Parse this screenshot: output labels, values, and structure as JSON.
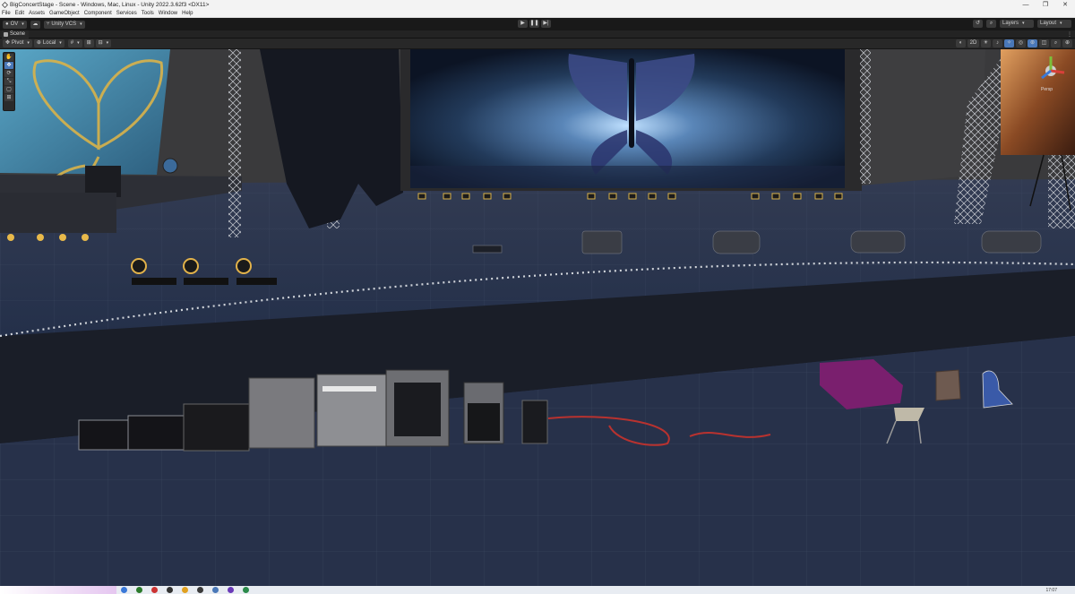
{
  "window": {
    "title": "BigConcertStage - Scene - Windows, Mac, Linux - Unity 2022.3.62f3 <DX11>",
    "controls": [
      "—",
      "❐",
      "✕"
    ]
  },
  "menu": [
    "File",
    "Edit",
    "Assets",
    "GameObject",
    "Component",
    "Services",
    "Tools",
    "Window",
    "Help"
  ],
  "main_toolbar": {
    "account": "OV",
    "version_control": "Unity VCS",
    "layers": "Layers",
    "layout": "Layout"
  },
  "scene_tab": {
    "label": "Scene"
  },
  "scene_toolbar": {
    "pivot": "Pivot",
    "space": "Local",
    "mode_2d": "2D"
  },
  "gizmo": {
    "label": "Persp"
  },
  "taskbar": {
    "clock": "17:07"
  },
  "colors": {
    "accent": "#4a78b8",
    "viewport_bg": "#27314a",
    "chrome_dark": "#191919",
    "chrome_mid": "#282828"
  }
}
